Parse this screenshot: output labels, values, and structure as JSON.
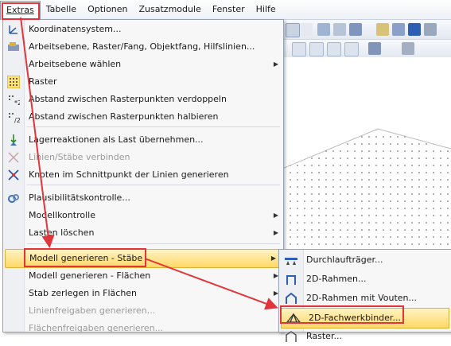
{
  "menubar": {
    "items": [
      "Extras",
      "Tabelle",
      "Optionen",
      "Zusatzmodule",
      "Fenster",
      "Hilfe"
    ]
  },
  "extras_menu": {
    "items": [
      {
        "label": "Koordinatensystem...",
        "icon": "coordinate-system-icon"
      },
      {
        "label": "Arbeitsebene, Raster/Fang, Objektfang, Hilfslinien...",
        "icon": "work-plane-icon"
      },
      {
        "label": "Arbeitsebene wählen",
        "icon": "",
        "submenu": true
      },
      {
        "label": "Raster",
        "icon": "grid-icon"
      },
      {
        "label": "Abstand zwischen Rasterpunkten verdoppeln",
        "icon": "grid-double-icon"
      },
      {
        "label": "Abstand zwischen Rasterpunkten halbieren",
        "icon": "grid-half-icon"
      },
      {
        "label": "Lagerreaktionen als Last übernehmen...",
        "icon": "support-reactions-icon"
      },
      {
        "label": "Linien/Stäbe verbinden",
        "icon": "connect-lines-icon",
        "disabled": true
      },
      {
        "label": "Knoten im Schnittpunkt der Linien generieren",
        "icon": "intersection-nodes-icon"
      },
      {
        "label": "Plausibilitätskontrolle...",
        "icon": "plausibility-check-icon"
      },
      {
        "label": "Modellkontrolle",
        "icon": "",
        "submenu": true
      },
      {
        "label": "Lasten löschen",
        "icon": "",
        "submenu": true
      },
      {
        "label": "Modell generieren - Stäbe",
        "icon": "",
        "submenu": true,
        "highlighted": true
      },
      {
        "label": "Modell generieren - Flächen",
        "icon": "",
        "submenu": true
      },
      {
        "label": "Stab zerlegen in Flächen",
        "icon": "",
        "submenu": true
      },
      {
        "label": "Linienfreigaben generieren...",
        "icon": "",
        "disabled": true
      },
      {
        "label": "Flächenfreigaben generieren...",
        "icon": "",
        "disabled": true
      }
    ]
  },
  "submenu": {
    "items": [
      {
        "label": "Durchlaufträger...",
        "icon": "continuous-beam-icon"
      },
      {
        "label": "2D-Rahmen...",
        "icon": "frame-2d-icon"
      },
      {
        "label": "2D-Rahmen mit Vouten...",
        "icon": "frame-haunch-icon"
      },
      {
        "label": "2D-Fachwerkbinder...",
        "icon": "truss-icon",
        "highlighted": true
      },
      {
        "label": "Raster...",
        "icon": "grid-structure-icon"
      }
    ]
  },
  "colors": {
    "highlight": "#ffd866",
    "annotation_red": "#e0353a",
    "toolbar_blue": "#2f5fb3"
  }
}
